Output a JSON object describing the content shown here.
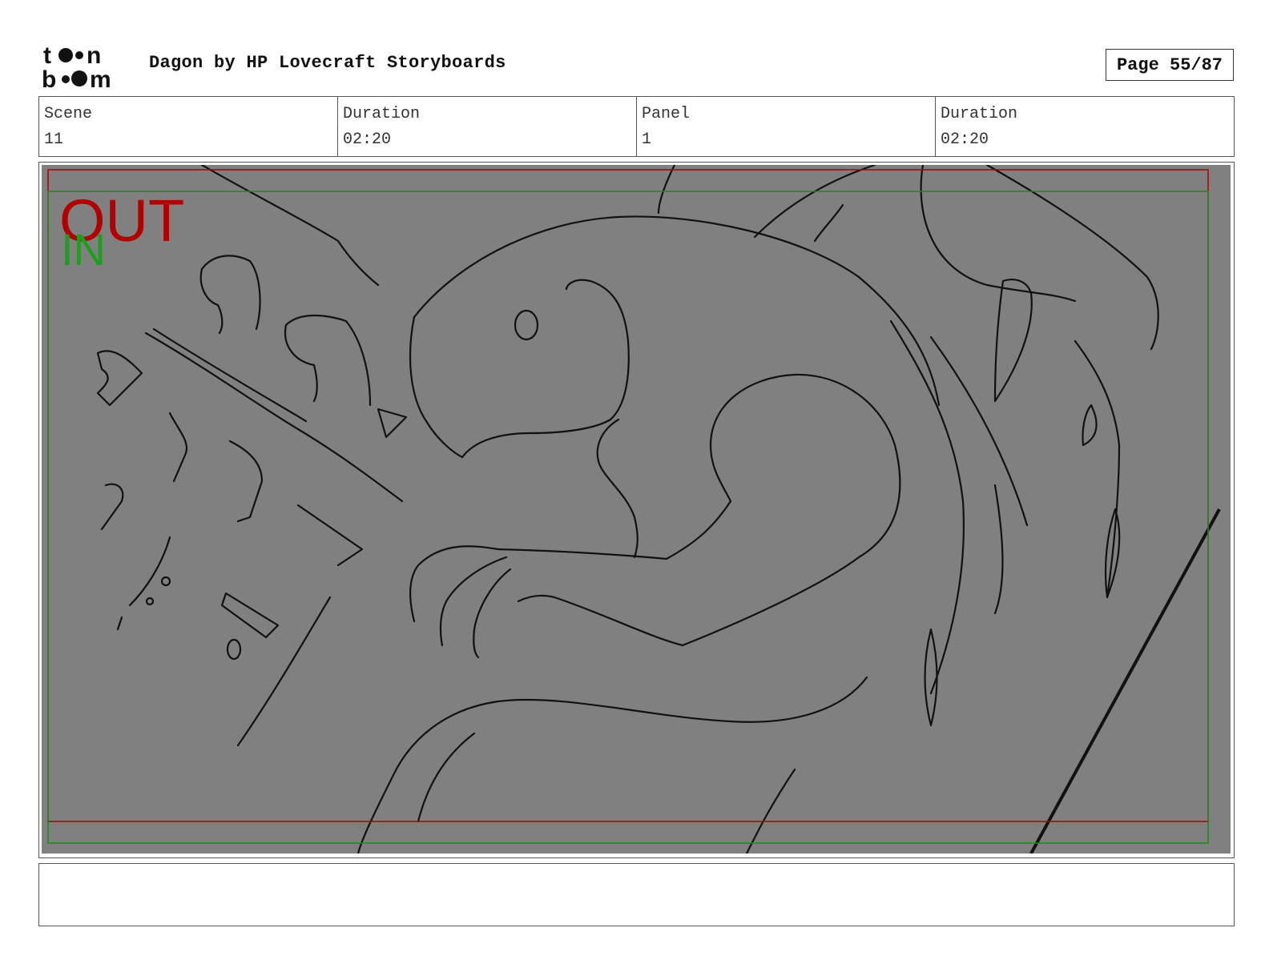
{
  "header": {
    "logo_text": "toon boom",
    "title": "Dagon by HP Lovecraft Storyboards",
    "page_label": "Page 55/87"
  },
  "info": {
    "scene_label": "Scene",
    "scene_value": "11",
    "scene_duration_label": "Duration",
    "scene_duration_value": "02:20",
    "panel_label": "Panel",
    "panel_value": "1",
    "panel_duration_label": "Duration",
    "panel_duration_value": "02:20"
  },
  "panel": {
    "out_label": "OUT",
    "in_label": "IN",
    "colors": {
      "background": "#808080",
      "out_frame": "#b00000",
      "in_frame": "#1a8a1a",
      "sketch": "#111111"
    }
  },
  "notes": {
    "text": ""
  }
}
